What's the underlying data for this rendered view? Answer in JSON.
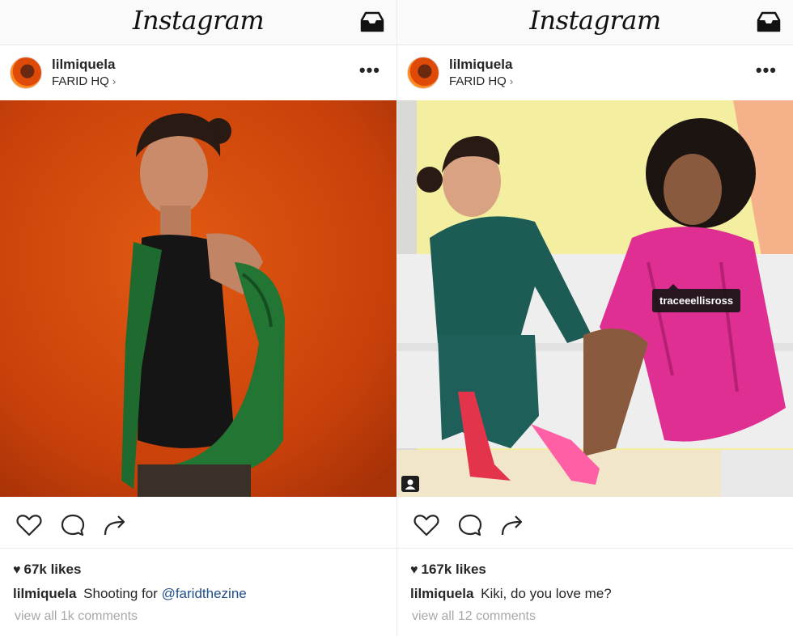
{
  "posts": [
    {
      "app_title": "Instagram",
      "username": "lilmiquela",
      "location": "FARID HQ",
      "more_label": "•••",
      "likes": "67k likes",
      "caption_user": "lilmiquela",
      "caption_text": "Shooting for",
      "caption_mention": "@faridthezine",
      "comments_link": "view all 1k comments"
    },
    {
      "app_title": "Instagram",
      "username": "lilmiquela",
      "location": "FARID HQ",
      "more_label": "•••",
      "photo_tag": "traceeellisross",
      "likes": "167k likes",
      "caption_user": "lilmiquela",
      "caption_text": "Kiki, do you love me?",
      "comments_link": "view all 12 comments"
    }
  ],
  "icons": {
    "inbox": "inbox-icon",
    "like": "heart-icon",
    "comment": "comment-icon",
    "share": "share-icon",
    "user_tag": "user-tag-icon",
    "location_chevron": "chevron-right-icon"
  },
  "colors": {
    "mention": "#1f4e8c",
    "muted": "#a8a8a8",
    "text": "#262626"
  }
}
